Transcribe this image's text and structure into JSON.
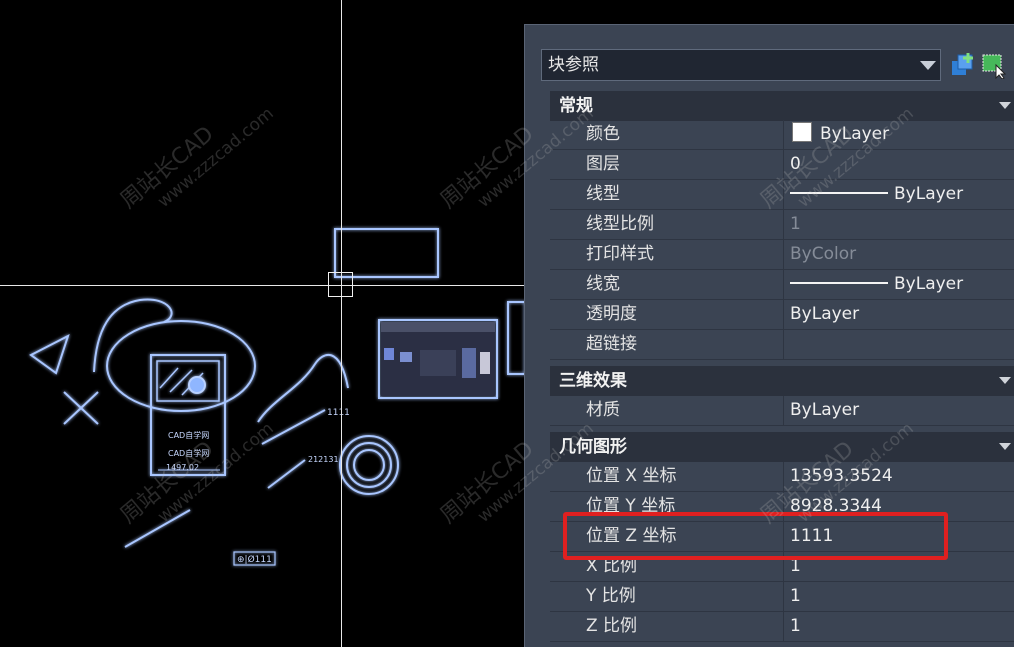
{
  "selector": {
    "value": "块参照"
  },
  "sections": {
    "general": {
      "title": "常规",
      "rows": [
        {
          "name": "颜色",
          "value": "ByLayer"
        },
        {
          "name": "图层",
          "value": "0"
        },
        {
          "name": "线型",
          "value": "ByLayer"
        },
        {
          "name": "线型比例",
          "value": "1"
        },
        {
          "name": "打印样式",
          "value": "ByColor"
        },
        {
          "name": "线宽",
          "value": "ByLayer"
        },
        {
          "name": "透明度",
          "value": "ByLayer"
        },
        {
          "name": "超链接",
          "value": ""
        }
      ]
    },
    "3d": {
      "title": "三维效果",
      "rows": [
        {
          "name": "材质",
          "value": "ByLayer"
        }
      ]
    },
    "geometry": {
      "title": "几何图形",
      "rows": [
        {
          "name": "位置 X 坐标",
          "value": "13593.3524"
        },
        {
          "name": "位置 Y 坐标",
          "value": "8928.3344"
        },
        {
          "name": "位置 Z 坐标",
          "value": "1111"
        },
        {
          "name": "X 比例",
          "value": "1"
        },
        {
          "name": "Y 比例",
          "value": "1"
        },
        {
          "name": "Z 比例",
          "value": "1"
        }
      ]
    }
  },
  "drawing": {
    "dim_1111": "1111",
    "dim_212131": "212131",
    "cad_label_1": "CAD自学网",
    "cad_label_2": "CAD自学网",
    "dim_1497": "1497.02",
    "tolerance": "⊕|Ø111"
  },
  "watermark": {
    "main": "周站长CAD",
    "sub": "www.zzzcad.com"
  },
  "colors": {
    "accent_highlight": "#e02020",
    "drawing_lines": "#8fb6ff",
    "panel_bg": "#3b4453"
  },
  "icons": [
    "color-swatch-icon",
    "quick-select-icon",
    "select-objects-icon",
    "collapse-chevron-icon"
  ]
}
